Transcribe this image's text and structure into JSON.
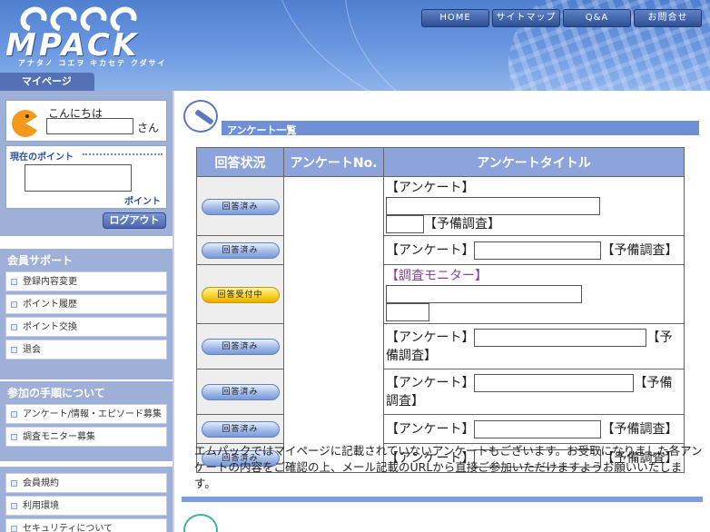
{
  "header": {
    "logo_text": "MPACK",
    "logo_sub": "アナタノ コエヲ キカセテ クダサイ",
    "nav": [
      {
        "label": "HOME"
      },
      {
        "label": "サイトマップ"
      },
      {
        "label": "Q&A"
      },
      {
        "label": "お問合せ"
      }
    ],
    "mypage_tab": "マイページ"
  },
  "sidebar": {
    "greeting": "こんにちは",
    "honorific": "さん",
    "points_title": "現在のポイント",
    "points_unit": "ポイント",
    "logout_label": "ログアウト",
    "support": {
      "title": "会員サポート",
      "items": [
        "登録内容変更",
        "ポイント履歴",
        "ポイント交換",
        "退会"
      ]
    },
    "procedure": {
      "title": "参加の手順について",
      "items": [
        "アンケート/情報・エピソード募集",
        "調査モニター募集"
      ]
    },
    "others": {
      "items": [
        "会員規約",
        "利用環境",
        "セキュリティについて"
      ]
    }
  },
  "main": {
    "section_title": "アンケート一覧",
    "table": {
      "headers": [
        "回答状況",
        "アンケートNo.",
        "アンケートタイトル"
      ],
      "rows": [
        {
          "status": "回答済み",
          "type": "done",
          "prefix": "【アンケート】",
          "suffix": "【予備調査】"
        },
        {
          "status": "回答済み",
          "type": "done",
          "prefix": "【アンケート】",
          "suffix": "【予備調査】"
        },
        {
          "status": "回答受付中",
          "type": "open",
          "prefix": "【調査モニター】",
          "suffix": ""
        },
        {
          "status": "回答済み",
          "type": "done",
          "prefix": "【アンケート】",
          "suffix": "【予備調査】"
        },
        {
          "status": "回答済み",
          "type": "done",
          "prefix": "【アンケート】",
          "suffix": "【予備調査】"
        },
        {
          "status": "回答済み",
          "type": "done",
          "prefix": "【アンケート】",
          "suffix": "【予備調査】"
        },
        {
          "status": "回答済み",
          "type": "done",
          "prefix": "【アンケート】",
          "suffix": "【予備調査】"
        }
      ]
    },
    "notice": "エムパックではマイページに記載されていないアンケートもございます。お受取になりました各アンケートの内容をご確認の上、メール記載のURLから直接ご参加いただけますようお願いいたします。"
  }
}
